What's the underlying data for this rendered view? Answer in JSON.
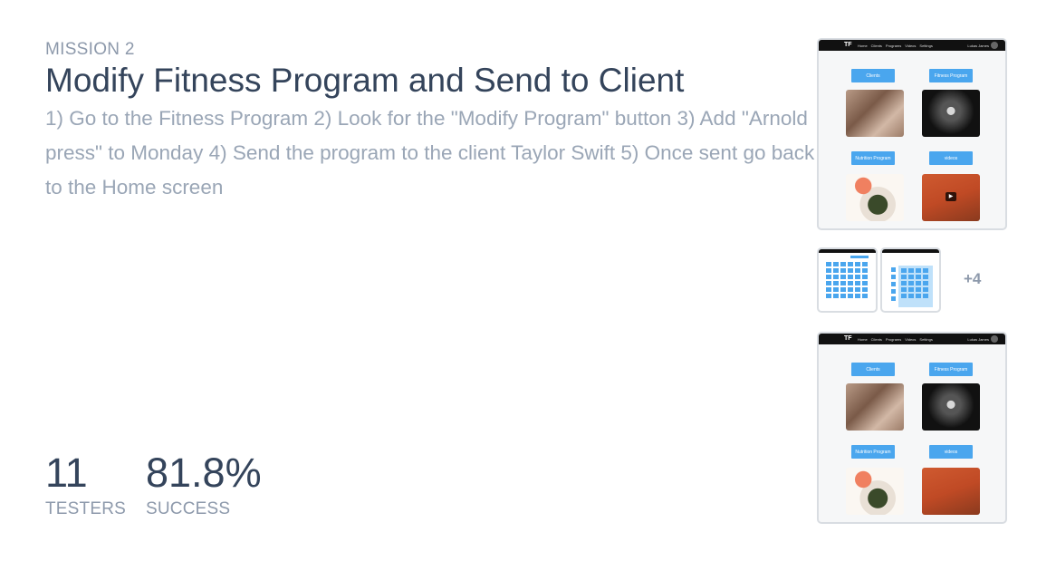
{
  "mission": {
    "label": "MISSION 2",
    "title": "Modify Fitness Program and Send to Client",
    "description": "1) Go to the Fitness Program 2) Look for the \"Modify Program\" button 3) Add \"Arnold press\" to Monday 4) Send the program to the client Taylor Swift 5) Once sent go back to the Home screen"
  },
  "stats": {
    "testers": {
      "value": "11",
      "label": "TESTERS"
    },
    "success": {
      "value": "81.8%",
      "label": "SUCCESS"
    }
  },
  "screens": {
    "nav": {
      "logo": "TF",
      "links": [
        "Home",
        "Clients",
        "Programs",
        "Videos",
        "Settings"
      ],
      "user": "Lukas James"
    },
    "tiles": {
      "clients": "Clients",
      "fitness": "Fitness Program",
      "nutrition": "Nutrition Program",
      "videos": "videos"
    },
    "more_count": "+4"
  }
}
